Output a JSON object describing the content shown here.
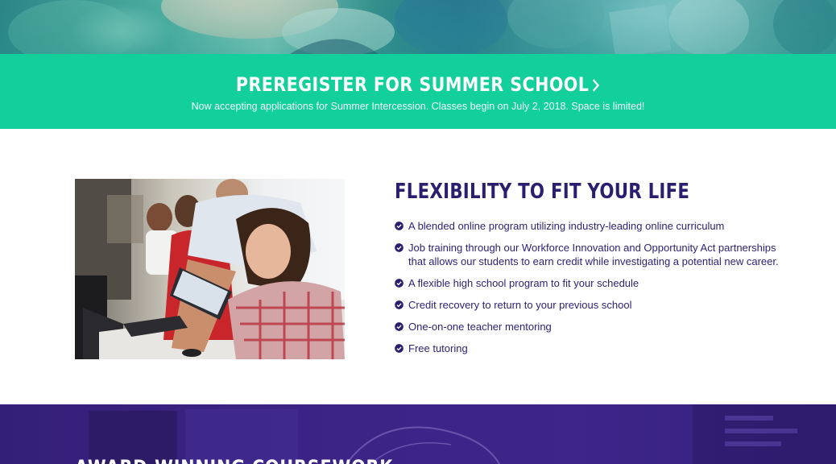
{
  "banner": {
    "title": "PREREGISTER FOR SUMMER SCHOOL",
    "subtitle": "Now accepting applications for Summer Intercession. Classes begin on July 2, 2018. Space is limited!",
    "chevron_icon": "chevron-right-icon"
  },
  "feature": {
    "heading": "FLEXIBILITY TO FIT YOUR LIFE",
    "items": [
      {
        "text": "A blended online program utilizing industry-leading online curriculum"
      },
      {
        "text": "Job training through our Workforce Innovation and Opportunity Act partnerships that allows our students to earn credit while investigating a potential new career."
      },
      {
        "text": "A flexible high school program to fit your schedule"
      },
      {
        "text": "Credit recovery to return to your previous school"
      },
      {
        "text": "One-on-one teacher mentoring"
      },
      {
        "text": "Free tutoring"
      }
    ],
    "check_icon": "check-circle-icon"
  },
  "section2": {
    "heading": "AWARD-WINNING COURSEWORK"
  },
  "colors": {
    "banner_green": "#12cf9b",
    "heading_navy": "#2a1e6e",
    "text_navy": "#2c2377",
    "purple": "#3c2487"
  }
}
